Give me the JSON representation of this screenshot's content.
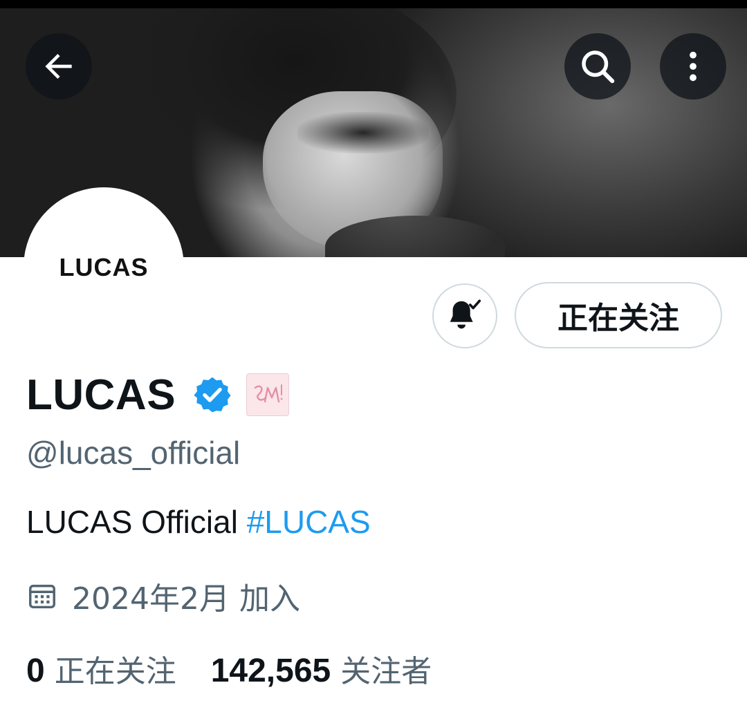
{
  "header": {
    "back_icon": "arrow-left-icon",
    "search_icon": "search-icon",
    "more_icon": "more-vertical-icon"
  },
  "profile": {
    "avatar_text": "LUCAS",
    "display_name": "LUCAS",
    "verified_color": "#1d9bf0",
    "handle": "@lucas_official",
    "bio_text": "LUCAS Official ",
    "bio_hashtag": "#LUCAS",
    "joined": "2024年2月 加入"
  },
  "actions": {
    "notify_icon": "bell-check-icon",
    "follow_label": "正在关注"
  },
  "stats": {
    "following_count": "0",
    "following_label": "正在关注",
    "followers_count": "142,565",
    "followers_label": "关注者"
  },
  "colors": {
    "accent": "#1d9bf0",
    "secondary_text": "#536471",
    "badge_bg": "#fbe6ea"
  }
}
